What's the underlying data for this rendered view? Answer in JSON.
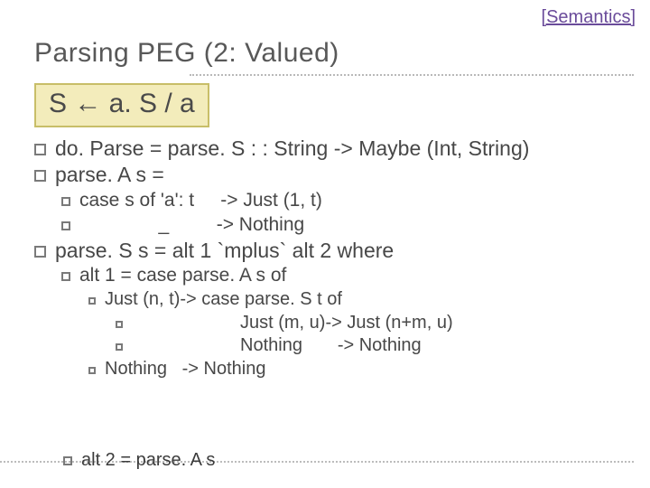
{
  "header": {
    "link": "[Semantics]"
  },
  "title": "Parsing PEG (2: Valued)",
  "rule": "S ← a. S / a",
  "lines": {
    "l1": "do. Parse = parse. S : : String -> Maybe (Int, String)",
    "l2": "parse. A s =",
    "l3": "case s of 'a': t     -> Just (1, t)",
    "l4": "               _         -> Nothing",
    "l5": "parse. S s = alt 1 `mplus` alt 2 where",
    "l6": "alt 1 = case parse. A s of",
    "l7": "Just (n, t)-> case parse. S t of",
    "l8": "Just (m, u)-> Just (n+m, u)",
    "l9": "Nothing       -> Nothing",
    "l10": "Nothing   -> Nothing",
    "l11": "alt 2 = parse. A s"
  }
}
